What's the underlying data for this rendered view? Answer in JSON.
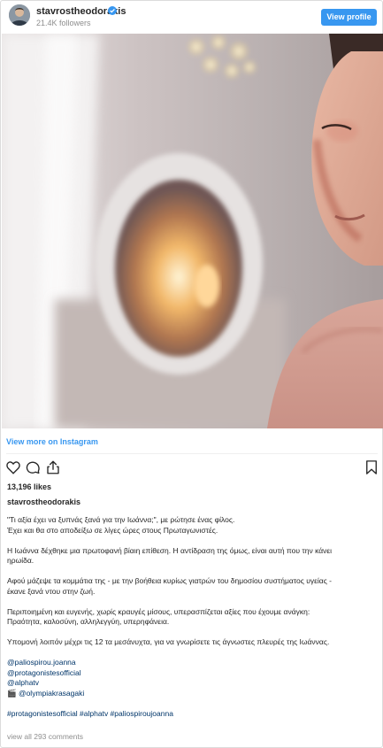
{
  "header": {
    "username": "stavrostheodorakis",
    "followers": "21.4K followers",
    "view_profile_label": "View profile"
  },
  "post": {
    "view_more_label": "View more on Instagram",
    "likes": "13,196 likes",
    "caption_user": "stavrostheodorakis",
    "caption": {
      "p1_l1": "\"Τι αξία έχει να ξυπνάς ξανά για την Ιωάννα;\", με ρώτησε ένας φίλος.",
      "p1_l2": "Έχει και θα στο αποδείξω σε λίγες ώρες στους Πρωταγωνιστές.",
      "p2_l1": "Η Ιωάννα δέχθηκε μια πρωτοφανή βίαιη επίθεση. Η αντίδραση της όμως, είναι αυτή που την κάνει",
      "p2_l2": "ηρωίδα.",
      "p3_l1": "Αφού μάζεψε τα κομμάτια της - με την βοήθεια κυρίως γιατρών του δημοσίου συστήματος υγείας -",
      "p3_l2": "έκανε ξανά ντου στην ζωή.",
      "p4_l1": "Περιποιημένη και ευγενής, χωρίς κραυγές μίσους, υπερασπίζεται αξίες που έχουμε ανάγκη:",
      "p4_l2": "Πραότητα, καλοσύνη, αλληλεγγύη, υπερηφάνεια.",
      "p5_l1": "Υπομονή λοιπόν μέχρι τις 12 τα μεσάνυχτα, για να γνωρίσετε τις άγνωστες πλευρές της Ιωάννας.",
      "mention1": "@paliospirou.joanna",
      "mention2": "@protagonistesofficial",
      "mention3": "@alphatv",
      "mention4_prefix": "🎬 ",
      "mention4": "@olympiakrasagaki",
      "hashtags": "#protagonistesofficial #alphatv #paliospiroujoanna"
    },
    "comments_label": "view all 293 comments"
  },
  "icons": {
    "heart": "heart-icon",
    "comment": "comment-icon",
    "share": "share-icon",
    "bookmark": "bookmark-icon",
    "verified": "verified-badge-icon"
  },
  "colors": {
    "accent": "#3897f0",
    "link": "#003569",
    "muted": "#8e8e8e"
  }
}
